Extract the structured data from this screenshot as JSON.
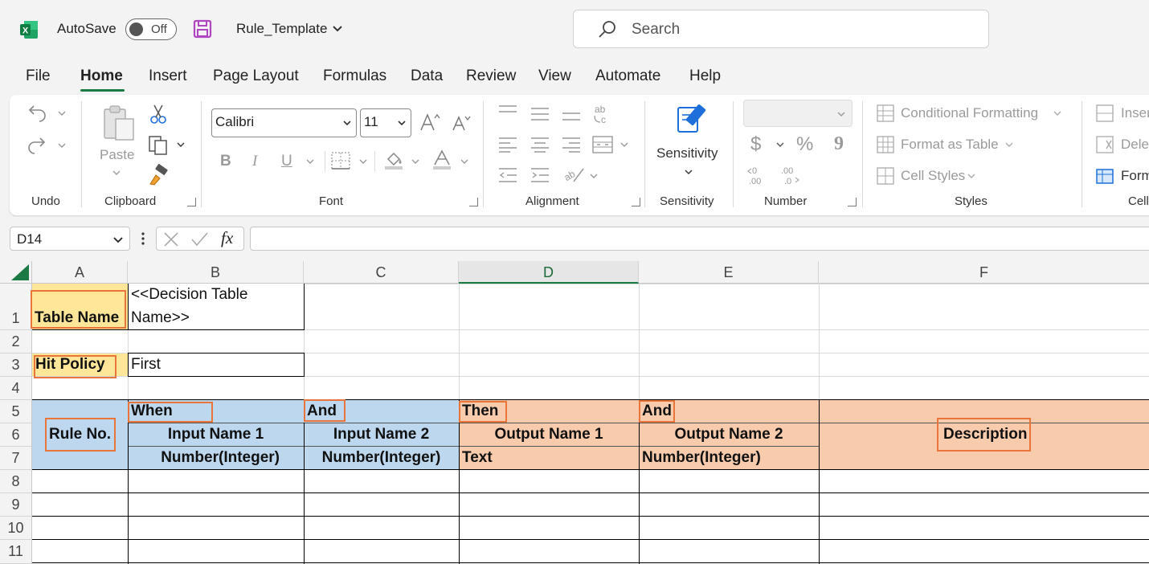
{
  "titlebar": {
    "autosave_label": "AutoSave",
    "autosave_state": "Off",
    "file_name": "Rule_Template",
    "search_placeholder": "Search"
  },
  "menu": {
    "tabs": [
      "File",
      "Home",
      "Insert",
      "Page Layout",
      "Formulas",
      "Data",
      "Review",
      "View",
      "Automate",
      "Help"
    ],
    "active": "Home"
  },
  "ribbon": {
    "undo": {
      "label": "Undo"
    },
    "clipboard": {
      "label": "Clipboard",
      "paste": "Paste"
    },
    "font": {
      "label": "Font",
      "family": "Calibri",
      "size": "11",
      "bold": "B",
      "italic": "I",
      "underline": "U"
    },
    "alignment": {
      "label": "Alignment"
    },
    "sensitivity": {
      "label": "Sensitivity",
      "button": "Sensitivity"
    },
    "number": {
      "label": "Number",
      "currency": "$",
      "percent": "%",
      "comma": "9"
    },
    "styles": {
      "label": "Styles",
      "items": [
        "Conditional Formatting",
        "Format as Table",
        "Cell Styles"
      ]
    },
    "cells": {
      "label": "Cells",
      "items": [
        "Insert",
        "Delete",
        "Format"
      ]
    }
  },
  "formula_bar": {
    "name_box": "D14",
    "fx": "fx",
    "value": ""
  },
  "sheet": {
    "columns": [
      "A",
      "B",
      "C",
      "D",
      "E",
      "F"
    ],
    "selected_column": "D",
    "rows": [
      "1",
      "2",
      "3",
      "4",
      "5",
      "6",
      "7",
      "8",
      "9",
      "10",
      "11"
    ],
    "cells": {
      "A1": "Table Name",
      "B1_line1": "<<Decision Table",
      "B1_line2": "Name>>",
      "A3": "Hit Policy",
      "B3": "First",
      "A5": "Rule No.",
      "B5": "When",
      "C5": "And",
      "D5": "Then",
      "E5": "And",
      "F5": "Description",
      "B6": "Input Name 1",
      "C6": "Input Name 2",
      "D6": "Output Name 1",
      "E6": "Output Name 2",
      "B7": "Number(Integer)",
      "C7": "Number(Integer)",
      "D7": "Text",
      "E7": "Number(Integer)"
    },
    "colors": {
      "yellow": "#ffe699",
      "blue": "#bdd7ee",
      "orange": "#f8cbad",
      "highlight": "#e9753a",
      "accent": "#1b7a43"
    }
  }
}
